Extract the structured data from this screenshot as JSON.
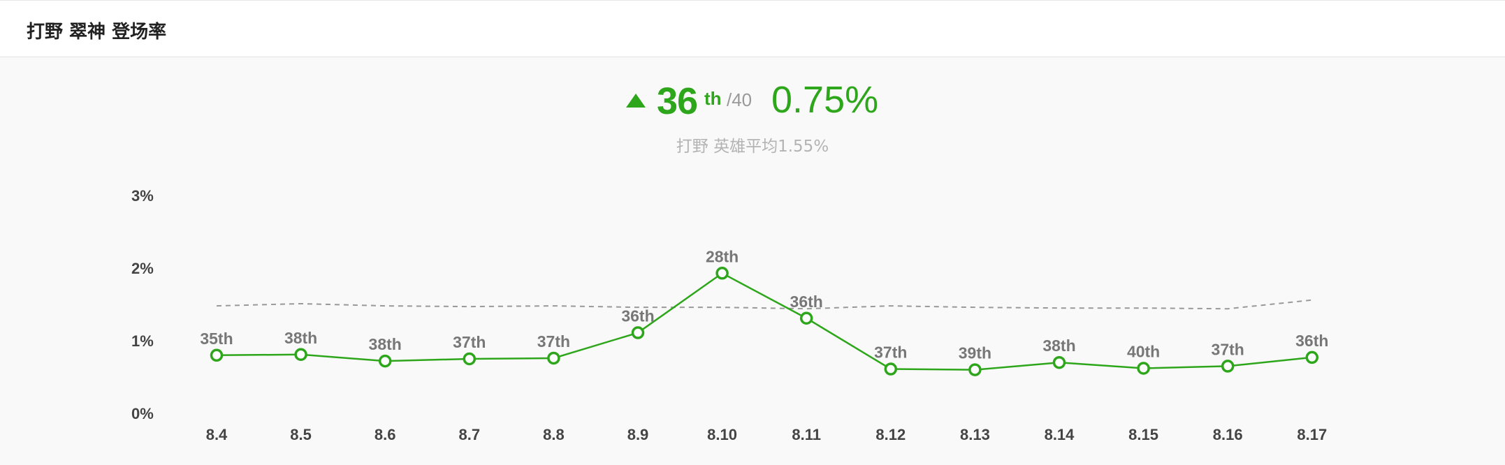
{
  "header": {
    "title": "打野 翠神 登场率"
  },
  "summary": {
    "rank": "36",
    "rank_suffix": "th",
    "rank_total": "/40",
    "rate": "0.75%",
    "avg_role": "打野",
    "avg_label": "英雄平均1.55%",
    "trend": "up",
    "accent_color": "#2ea61b"
  },
  "chart_data": {
    "type": "line",
    "categories": [
      "8.4",
      "8.5",
      "8.6",
      "8.7",
      "8.8",
      "8.9",
      "8.10",
      "8.11",
      "8.12",
      "8.13",
      "8.14",
      "8.15",
      "8.16",
      "8.17"
    ],
    "yticks": [
      "0%",
      "1%",
      "2%",
      "3%"
    ],
    "ylim": [
      0,
      3
    ],
    "grid": false,
    "series": [
      {
        "color": "#2ea61b",
        "values": [
          0.8,
          0.81,
          0.72,
          0.75,
          0.76,
          1.11,
          1.93,
          1.31,
          0.61,
          0.6,
          0.7,
          0.62,
          0.65,
          0.77
        ],
        "labels": [
          "35th",
          "38th",
          "38th",
          "37th",
          "37th",
          "36th",
          "28th",
          "36th",
          "37th",
          "39th",
          "38th",
          "40th",
          "37th",
          "36th"
        ]
      },
      {
        "color": "#999999",
        "style": "dashed",
        "values": [
          1.48,
          1.51,
          1.48,
          1.47,
          1.48,
          1.46,
          1.46,
          1.44,
          1.48,
          1.46,
          1.45,
          1.45,
          1.44,
          1.56
        ]
      }
    ]
  }
}
